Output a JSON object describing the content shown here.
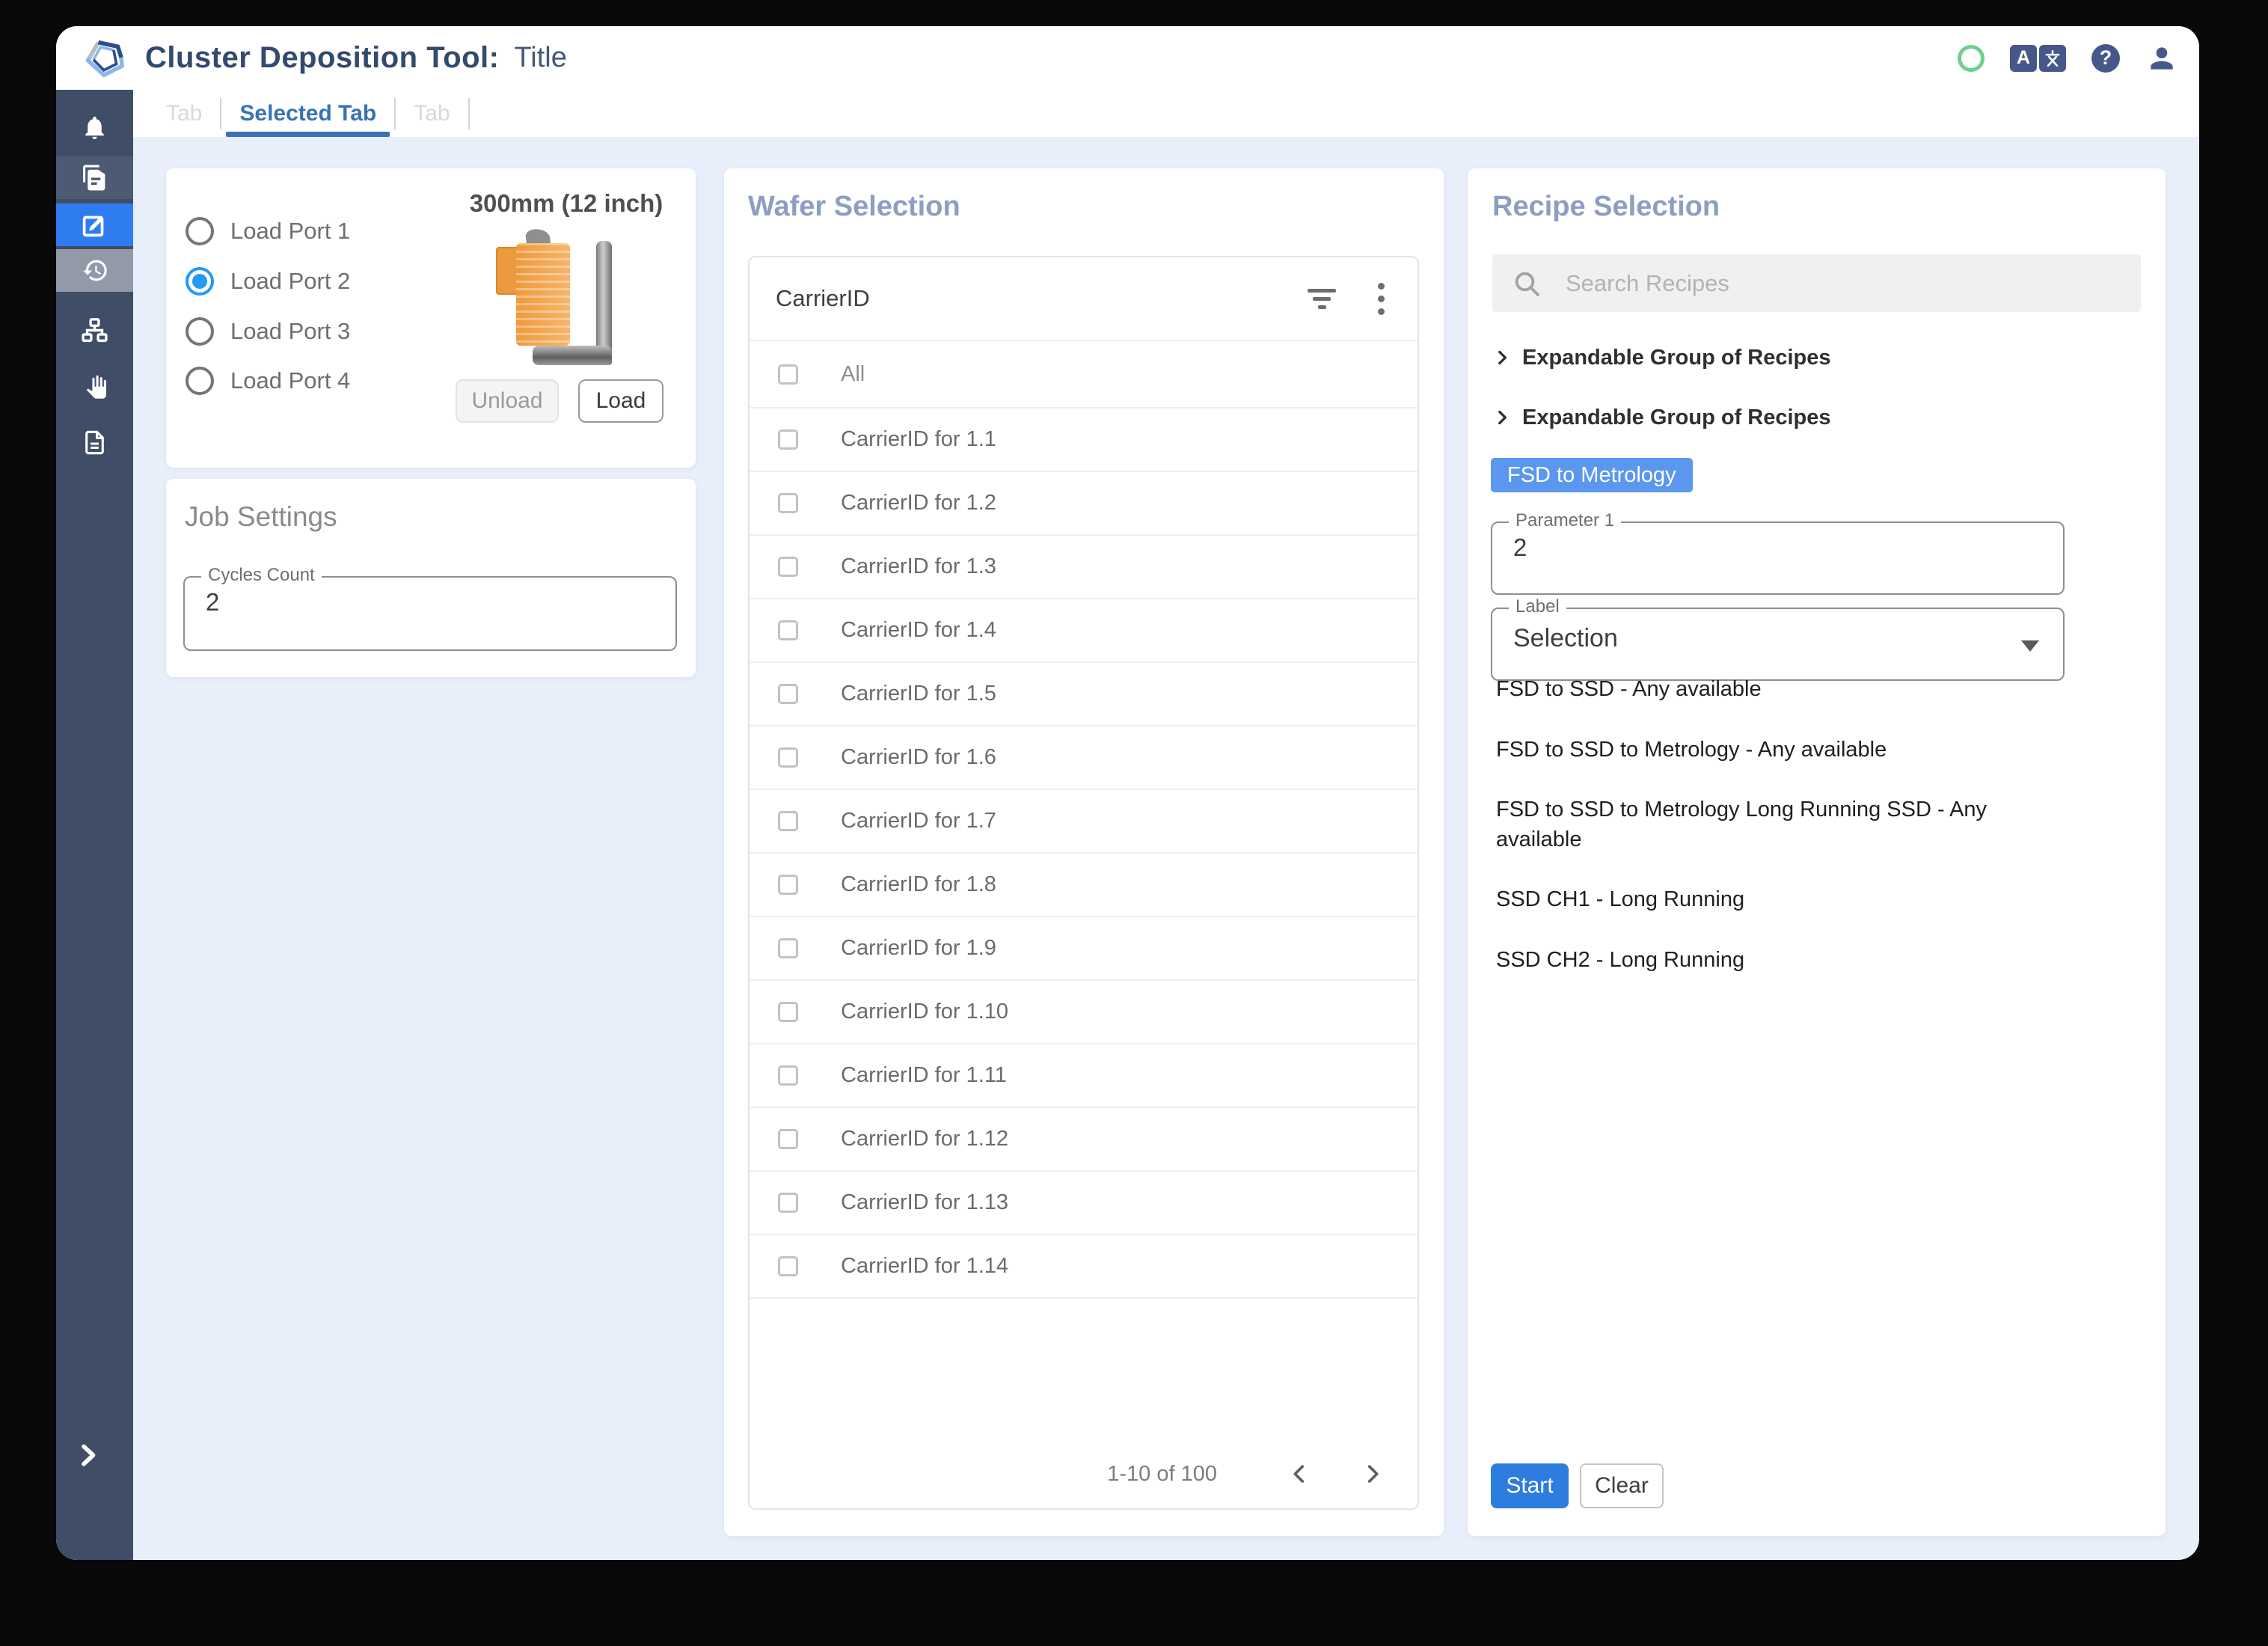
{
  "header": {
    "app_title": "Cluster Deposition Tool:",
    "doc_title": "Title",
    "status_color": "#6fcf8f",
    "icon_color": "#46588a"
  },
  "tabs": {
    "items": [
      {
        "label": "Tab",
        "active": false
      },
      {
        "label": "Selected Tab",
        "active": true
      },
      {
        "label": "Tab",
        "active": false
      }
    ],
    "active_color": "#3a72b4"
  },
  "sidebar": {
    "background": "#404d66",
    "active_color": "#2e7cf0",
    "items": [
      {
        "icon": "bell"
      },
      {
        "icon": "copy-document"
      },
      {
        "icon": "edit",
        "active": true
      },
      {
        "icon": "history"
      },
      {
        "icon": "sitemap"
      },
      {
        "icon": "hand"
      },
      {
        "icon": "document"
      }
    ],
    "expand_icon": "chevron-right"
  },
  "load_port": {
    "options": [
      {
        "label": "Load Port 1",
        "selected": false
      },
      {
        "label": "Load Port 2",
        "selected": true
      },
      {
        "label": "Load Port 3",
        "selected": false
      },
      {
        "label": "Load Port 4",
        "selected": false
      }
    ],
    "wafer_size_label": "300mm (12 inch)",
    "unload_button": "Unload",
    "load_button": "Load"
  },
  "job_settings": {
    "title": "Job Settings",
    "cycles_field": {
      "label": "Cycles Count",
      "value": "2"
    }
  },
  "wafer_selection": {
    "title": "Wafer Selection",
    "column_header": "CarrierID",
    "select_all": "All",
    "rows": [
      "CarrierID for 1.1",
      "CarrierID for 1.2",
      "CarrierID for 1.3",
      "CarrierID for 1.4",
      "CarrierID for 1.5",
      "CarrierID for 1.6",
      "CarrierID for 1.7",
      "CarrierID for 1.8",
      "CarrierID for 1.9",
      "CarrierID for 1.10",
      "CarrierID for 1.11",
      "CarrierID for 1.12",
      "CarrierID for 1.13",
      "CarrierID for 1.14"
    ],
    "pagination": {
      "range_text": "1-10 of 100"
    }
  },
  "recipe_selection": {
    "title": "Recipe Selection",
    "search_placeholder": "Search Recipes",
    "groups": [
      "Expandable Group of Recipes",
      "Expandable Group of Recipes"
    ],
    "selected_recipe": {
      "label": "FSD to Metrology",
      "color": "#5b97ef"
    },
    "parameter_field": {
      "label": "Parameter 1",
      "value": "2"
    },
    "label_field": {
      "label": "Label",
      "value": "Selection"
    },
    "recipes": [
      "FSD to SSD - Any available",
      "FSD to SSD to Metrology - Any available",
      "FSD to SSD to Metrology Long Running SSD - Any available",
      "SSD CH1 - Long Running",
      "SSD CH2 - Long Running"
    ],
    "start_button": "Start",
    "clear_button": "Clear"
  }
}
